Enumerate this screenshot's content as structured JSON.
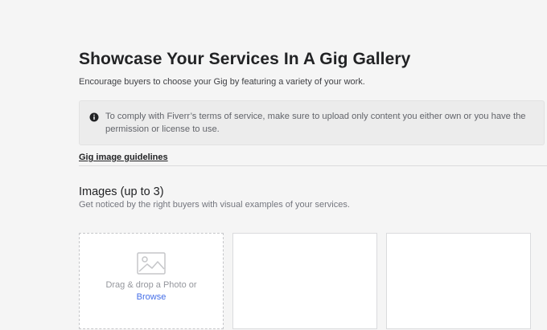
{
  "header": {
    "title": "Showcase Your Services In A Gig Gallery",
    "subtitle": "Encourage buyers to choose your Gig by featuring a variety of your work."
  },
  "notice": {
    "icon": "info-icon",
    "text": "To comply with Fiverr’s terms of service, make sure to upload only content you either own or you have the permission or license to use."
  },
  "guidelines_link": "Gig image guidelines",
  "images": {
    "heading": "Images (up to 3)",
    "subheading": "Get noticed by the right buyers with visual examples of your services.",
    "upload": {
      "icon": "photo-placeholder-icon",
      "drop_text": "Drag & drop a Photo or",
      "browse_label": "Browse"
    }
  },
  "colors": {
    "background": "#f5f5f5",
    "link": "#446ee7",
    "notice_bg": "#ececec"
  }
}
